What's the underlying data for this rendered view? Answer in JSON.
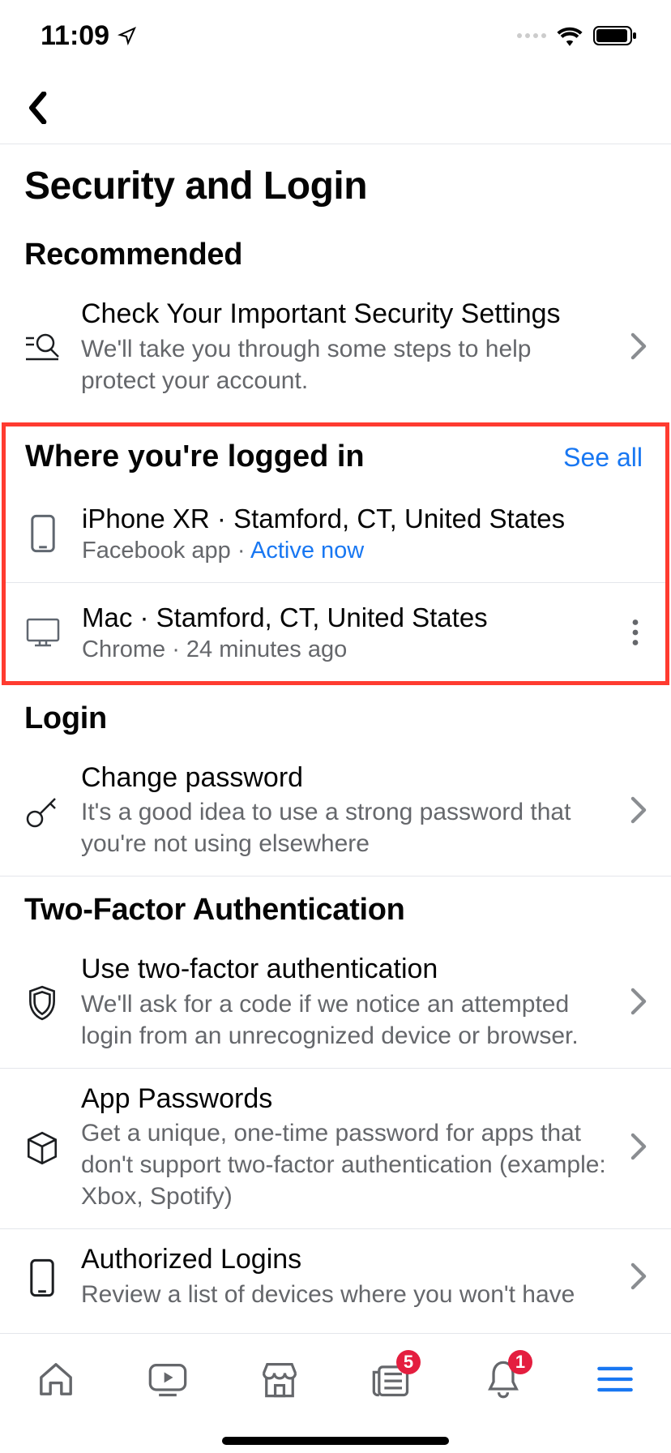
{
  "status": {
    "time": "11:09"
  },
  "page": {
    "title": "Security and Login"
  },
  "recommended": {
    "heading": "Recommended",
    "item": {
      "title": "Check Your Important Security Settings",
      "sub": "We'll take you through some steps to help protect your account."
    }
  },
  "logged_in": {
    "heading": "Where you're logged in",
    "see_all": "See all",
    "sessions": [
      {
        "line1": "iPhone XR · Stamford, CT, United States",
        "app": "Facebook app · ",
        "status": "Active now"
      },
      {
        "line1": "Mac · Stamford, CT, United States",
        "app": "Chrome · ",
        "time": "24 minutes ago"
      }
    ]
  },
  "login": {
    "heading": "Login",
    "change_password": {
      "title": "Change password",
      "sub": "It's a good idea to use a strong password that you're not using elsewhere"
    }
  },
  "twofa": {
    "heading": "Two-Factor Authentication",
    "use": {
      "title": "Use two-factor authentication",
      "sub": "We'll ask for a code if we notice an attempted login from an unrecognized device or browser."
    },
    "app_passwords": {
      "title": "App Passwords",
      "sub": "Get a unique, one-time password for apps that don't support two-factor authentication (example: Xbox, Spotify)"
    },
    "authorized": {
      "title": "Authorized Logins",
      "sub": "Review a list of devices where you won't have"
    }
  },
  "tabs": {
    "news_badge": "5",
    "bell_badge": "1"
  }
}
